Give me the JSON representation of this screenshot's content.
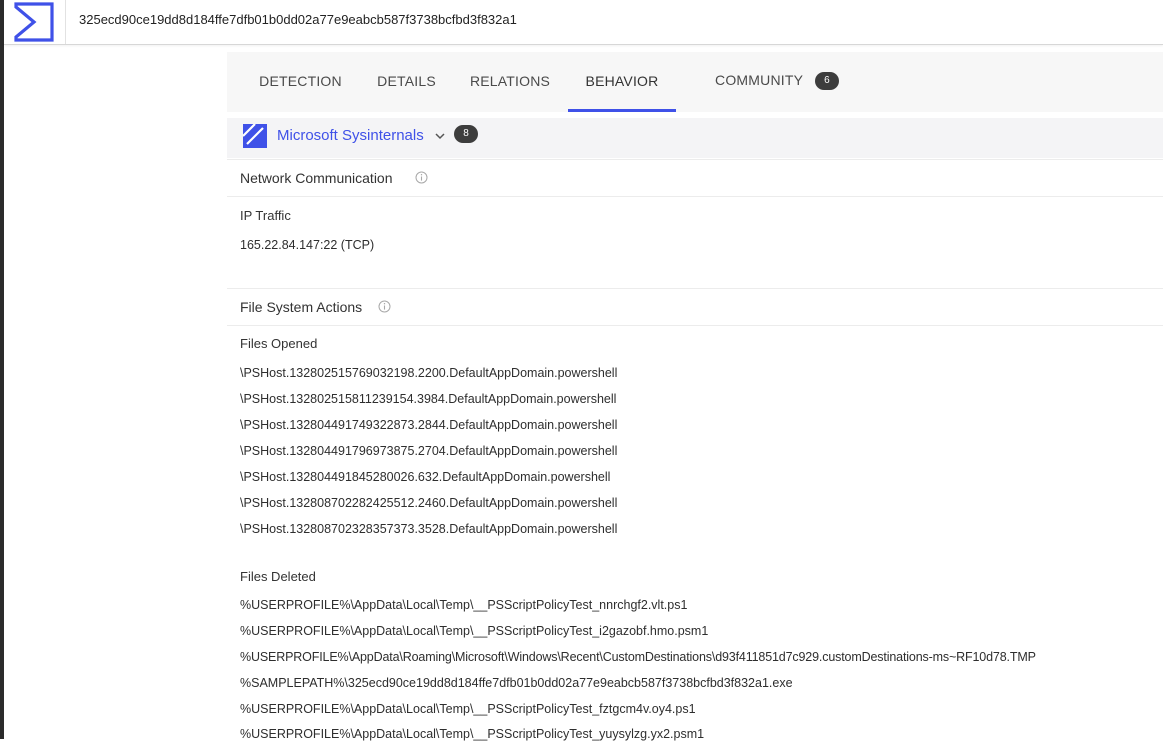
{
  "header": {
    "hash": "325ecd90ce19dd8d184ffe7dfb01b0dd02a77e9eabcb587f3738bcfbd3f832a1"
  },
  "tabs": [
    {
      "label": "DETECTION"
    },
    {
      "label": "DETAILS"
    },
    {
      "label": "RELATIONS"
    },
    {
      "label": "BEHAVIOR",
      "active": true
    },
    {
      "label": "COMMUNITY",
      "badge": "6"
    }
  ],
  "sandbox": {
    "name": "Microsoft Sysinternals",
    "count": "8"
  },
  "network": {
    "title": "Network Communication",
    "ip_traffic_label": "IP Traffic",
    "ip_traffic": [
      "165.22.84.147:22 (TCP)"
    ]
  },
  "filesystem": {
    "title": "File System Actions",
    "opened_label": "Files Opened",
    "opened": [
      "\\PSHost.132802515769032198.2200.DefaultAppDomain.powershell",
      "\\PSHost.132802515811239154.3984.DefaultAppDomain.powershell",
      "\\PSHost.132804491749322873.2844.DefaultAppDomain.powershell",
      "\\PSHost.132804491796973875.2704.DefaultAppDomain.powershell",
      "\\PSHost.132804491845280026.632.DefaultAppDomain.powershell",
      "\\PSHost.132808702282425512.2460.DefaultAppDomain.powershell",
      "\\PSHost.132808702328357373.3528.DefaultAppDomain.powershell"
    ],
    "deleted_label": "Files Deleted",
    "deleted": [
      "%USERPROFILE%\\AppData\\Local\\Temp\\__PSScriptPolicyTest_nnrchgf2.vlt.ps1",
      "%USERPROFILE%\\AppData\\Local\\Temp\\__PSScriptPolicyTest_i2gazobf.hmo.psm1",
      "%USERPROFILE%\\AppData\\Roaming\\Microsoft\\Windows\\Recent\\CustomDestinations\\d93f411851d7c929.customDestinations-ms~RF10d78.TMP",
      "%SAMPLEPATH%\\325ecd90ce19dd8d184ffe7dfb01b0dd02a77e9eabcb587f3738bcfbd3f832a1.exe",
      "%USERPROFILE%\\AppData\\Local\\Temp\\__PSScriptPolicyTest_fztgcm4v.oy4.ps1",
      "%USERPROFILE%\\AppData\\Local\\Temp\\__PSScriptPolicyTest_yuysylzg.yx2.psm1"
    ]
  },
  "colors": {
    "accent": "#3f51e8",
    "badge": "#3d3d3d"
  },
  "icons": {
    "logo": "virustotal-logo-icon",
    "sandbox": "sysinternals-icon",
    "chevron": "chevron-down-icon",
    "info": "info-icon"
  }
}
